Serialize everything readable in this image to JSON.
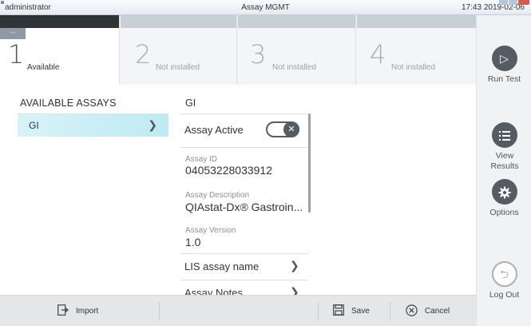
{
  "window": {
    "user": "administrator",
    "title": "Assay MGMT",
    "datetime": "17:43 2019-02-06"
  },
  "modules": [
    {
      "number": "1",
      "status": "Available",
      "tag": "---",
      "active": true
    },
    {
      "number": "2",
      "status": "Not installed",
      "active": false
    },
    {
      "number": "3",
      "status": "Not installed",
      "active": false
    },
    {
      "number": "4",
      "status": "Not installed",
      "active": false
    }
  ],
  "assay_list": {
    "header": "AVAILABLE ASSAYS",
    "items": [
      {
        "label": "GI",
        "selected": true
      }
    ]
  },
  "details": {
    "header": "GI",
    "assay_active_label": "Assay Active",
    "assay_active": false,
    "assay_id_label": "Assay ID",
    "assay_id": "04053228033912",
    "assay_description_label": "Assay Description",
    "assay_description": "QIAstat-Dx® Gastroin...",
    "assay_version_label": "Assay Version",
    "assay_version": "1.0",
    "lis_assay_name": "LIS assay name",
    "assay_notes": "Assay Notes"
  },
  "sidebar": {
    "run_test": "Run Test",
    "view_results": "View Results",
    "options": "Options",
    "log_out": "Log Out"
  },
  "toolbar": {
    "import": "Import",
    "save": "Save",
    "cancel": "Cancel"
  },
  "colors": {
    "selected_row": "#c4ecf4",
    "active_module_bar": "#2f3437",
    "icon_dark": "#555d63"
  }
}
